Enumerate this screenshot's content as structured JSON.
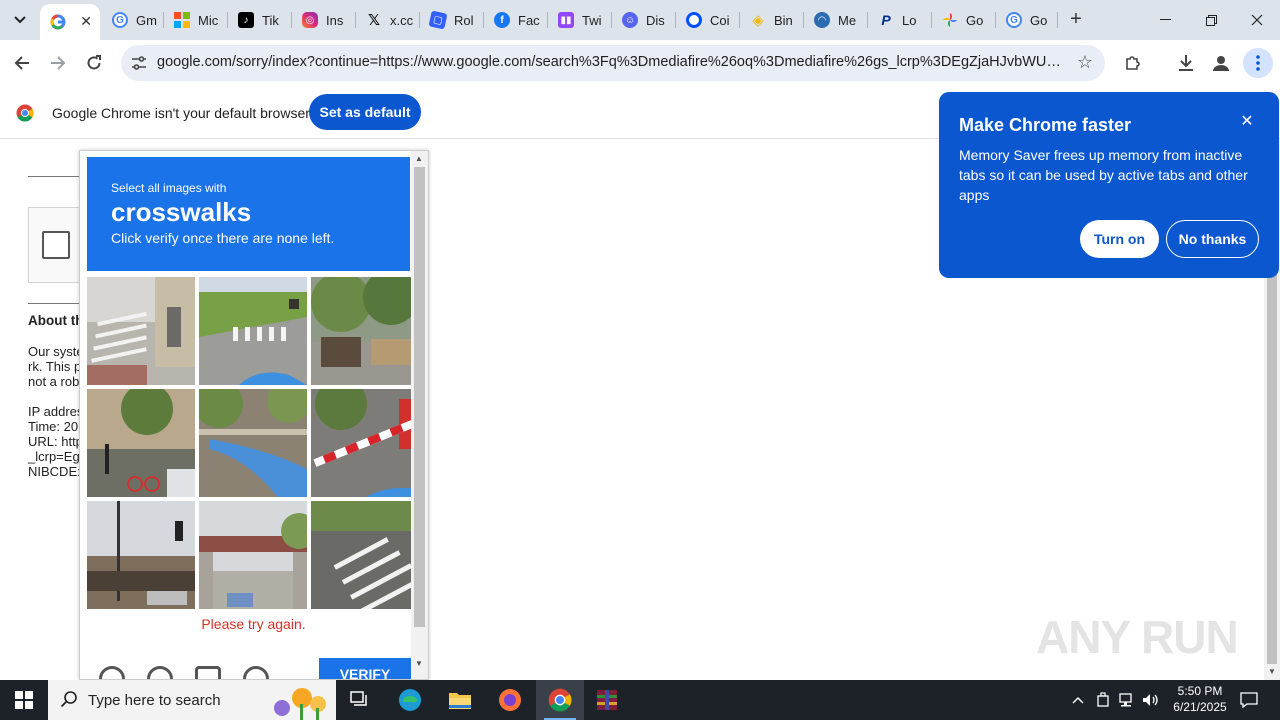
{
  "tabs": [
    {
      "title": "",
      "active": true,
      "favicon": "google-g-icon"
    },
    {
      "title": "Gm",
      "favicon": "google-g-icon"
    },
    {
      "title": "Mic",
      "favicon": "microsoft-icon"
    },
    {
      "title": "Tik",
      "favicon": "tiktok-icon"
    },
    {
      "title": "Ins",
      "favicon": "instagram-icon"
    },
    {
      "title": "x.cc",
      "favicon": "x-icon"
    },
    {
      "title": "Rol",
      "favicon": "roblox-icon"
    },
    {
      "title": "Fac",
      "favicon": "facebook-icon"
    },
    {
      "title": "Twi",
      "favicon": "twitch-icon"
    },
    {
      "title": "Dis",
      "favicon": "discord-icon"
    },
    {
      "title": "Coi",
      "favicon": "coinbase-icon"
    },
    {
      "title": "Bin",
      "favicon": "binance-icon"
    },
    {
      "title": "Me",
      "favicon": "metamask-icon"
    },
    {
      "title": "Lo",
      "favicon": "paypal-icon"
    },
    {
      "title": "Go",
      "favicon": "google-photos-icon"
    },
    {
      "title": "Go",
      "favicon": "google-g-icon"
    }
  ],
  "address_bar": {
    "url": "google.com/sorry/index?continue=https://www.google.com/search%3Fq%3Dmediafire%26oq%3Dmediafire%26gs_lcrp%3DEgZjaHJvbWUyBggA..."
  },
  "infobar": {
    "message": "Google Chrome isn't your default browser",
    "button": "Set as default"
  },
  "page": {
    "about_heading": "About th",
    "para_lines": [
      "Our syste",
      "rk. This p",
      "not a rob"
    ],
    "info_lines": [
      "IP addres",
      "Time: 20",
      "URL: http",
      "_lcrp=Eg",
      "NIBCDE:"
    ]
  },
  "captcha": {
    "instruction_small": "Select all images with",
    "target": "crosswalks",
    "instruction_tail": "Click verify once there are none left.",
    "error": "Please try again.",
    "verify_label": "VERIFY"
  },
  "promo": {
    "title": "Make Chrome faster",
    "body": "Memory Saver frees up memory from inactive tabs so it can be used by active tabs and other apps",
    "primary": "Turn on",
    "secondary": "No thanks"
  },
  "watermark": "ANY RUN",
  "taskbar": {
    "search_placeholder": "Type here to search",
    "time": "5:50 PM",
    "date": "6/21/2025"
  },
  "colors": {
    "chrome_blue": "#0b57d0",
    "captcha_blue": "#1a73e8",
    "error_red": "#d93025"
  }
}
